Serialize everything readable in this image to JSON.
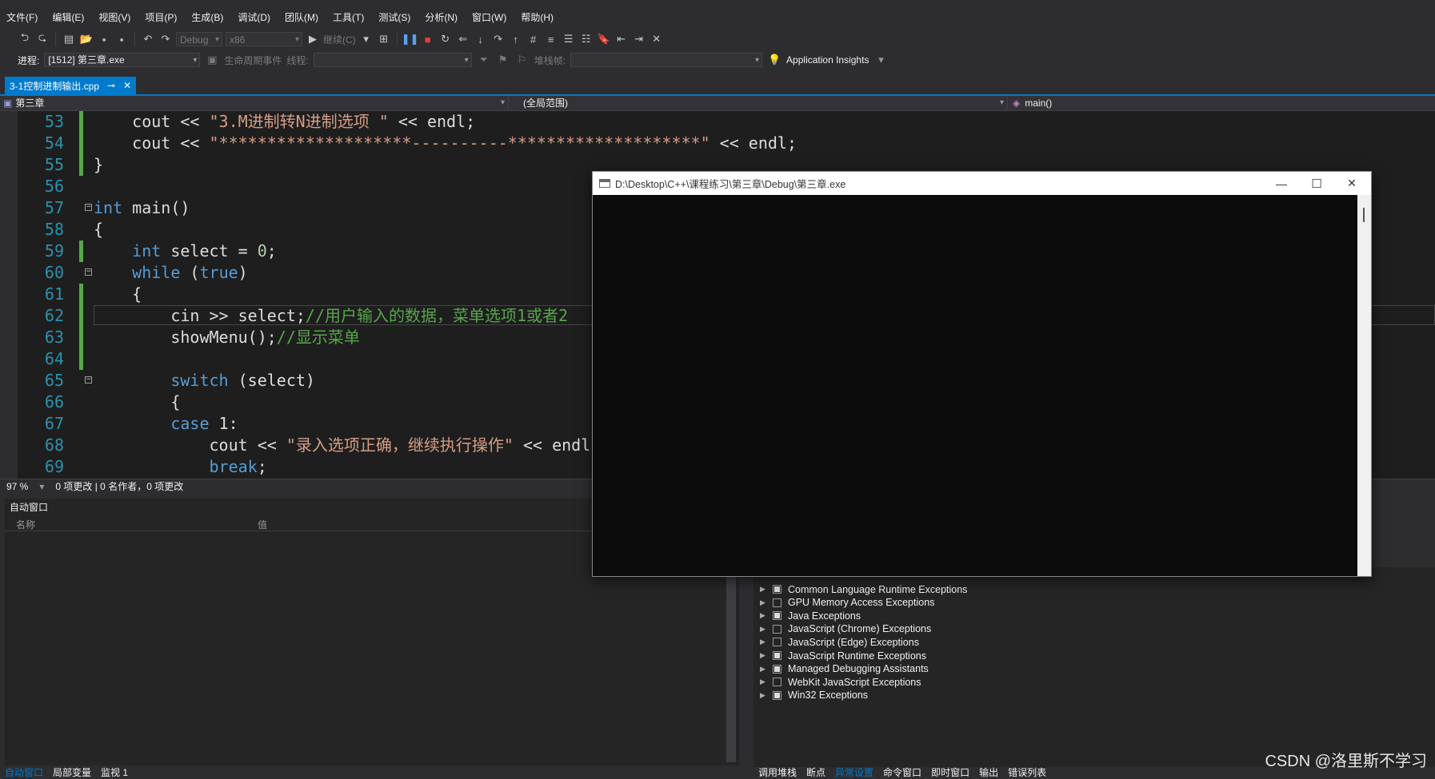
{
  "menu": [
    "文件(F)",
    "编辑(E)",
    "视图(V)",
    "项目(P)",
    "生成(B)",
    "调试(D)",
    "团队(M)",
    "工具(T)",
    "测试(S)",
    "分析(N)",
    "窗口(W)",
    "帮助(H)"
  ],
  "toolbar": {
    "config": "Debug",
    "platform": "x86",
    "continue_label": "继续(C)"
  },
  "process_bar": {
    "process_label": "进程:",
    "process_value": "[1512] 第三章.exe",
    "lifecycle_label": "生命周期事件",
    "thread_label": "线程:",
    "stack_label": "堆栈帧:",
    "insights_label": "Application Insights"
  },
  "editor_tab": {
    "title": "3-1控制进制输出.cpp",
    "pin": "⊸",
    "close": "✕"
  },
  "navbar": {
    "project": "第三章",
    "scope": "(全局范围)",
    "member": "main()"
  },
  "code_lines": [
    {
      "num": "53",
      "parts": [
        [
          "",
          "    cout << "
        ],
        [
          "str",
          "\"3.M进制转N进制选项 \""
        ],
        [
          "",
          " << endl;"
        ]
      ]
    },
    {
      "num": "54",
      "parts": [
        [
          "",
          "    cout << "
        ],
        [
          "str",
          "\"********************----------********************\""
        ],
        [
          "",
          " << endl;"
        ]
      ]
    },
    {
      "num": "55",
      "parts": [
        [
          "",
          "}"
        ]
      ]
    },
    {
      "num": "56",
      "parts": []
    },
    {
      "num": "57",
      "parts": [
        [
          "kw",
          "int"
        ],
        [
          "",
          " main()"
        ]
      ]
    },
    {
      "num": "58",
      "parts": [
        [
          "",
          "{"
        ]
      ]
    },
    {
      "num": "59",
      "parts": [
        [
          "",
          "    "
        ],
        [
          "kw",
          "int"
        ],
        [
          "",
          " select = "
        ],
        [
          "num",
          "0"
        ],
        [
          "",
          ";"
        ]
      ]
    },
    {
      "num": "60",
      "parts": [
        [
          "",
          "    "
        ],
        [
          "kw",
          "while"
        ],
        [
          "",
          " ("
        ],
        [
          "kw",
          "true"
        ],
        [
          "",
          ")"
        ]
      ]
    },
    {
      "num": "61",
      "parts": [
        [
          "",
          "    {"
        ]
      ]
    },
    {
      "num": "62",
      "parts": [
        [
          "",
          "        cin >> select;"
        ],
        [
          "cm",
          "//用户输入的数据，菜单选项1或者2"
        ]
      ]
    },
    {
      "num": "63",
      "parts": [
        [
          "",
          "        showMenu();"
        ],
        [
          "cm",
          "//显示菜单"
        ]
      ]
    },
    {
      "num": "64",
      "parts": []
    },
    {
      "num": "65",
      "parts": [
        [
          "",
          "        "
        ],
        [
          "kw",
          "switch"
        ],
        [
          "",
          " (select)"
        ]
      ]
    },
    {
      "num": "66",
      "parts": [
        [
          "",
          "        {"
        ]
      ]
    },
    {
      "num": "67",
      "parts": [
        [
          "",
          "        "
        ],
        [
          "kw",
          "case"
        ],
        [
          "",
          " 1:"
        ]
      ]
    },
    {
      "num": "68",
      "parts": [
        [
          "",
          "            cout << "
        ],
        [
          "str",
          "\"录入选项正确，继续执行操作\""
        ],
        [
          "",
          " << endl;"
        ]
      ]
    },
    {
      "num": "69",
      "parts": [
        [
          "",
          "            "
        ],
        [
          "kw",
          "break"
        ],
        [
          "",
          ";"
        ]
      ]
    }
  ],
  "editor_status": {
    "zoom": "97 %",
    "changes": "0 项更改 | 0 名作者，0 项更改"
  },
  "auto_window": {
    "title": "自动窗口",
    "col_name": "名称",
    "col_value": "值"
  },
  "exceptions": [
    {
      "label": "Common Language Runtime Exceptions",
      "checked": true
    },
    {
      "label": "GPU Memory Access Exceptions",
      "checked": false
    },
    {
      "label": "Java Exceptions",
      "checked": true
    },
    {
      "label": "JavaScript (Chrome) Exceptions",
      "checked": false
    },
    {
      "label": "JavaScript (Edge) Exceptions",
      "checked": false
    },
    {
      "label": "JavaScript Runtime Exceptions",
      "checked": true
    },
    {
      "label": "Managed Debugging Assistants",
      "checked": true
    },
    {
      "label": "WebKit JavaScript Exceptions",
      "checked": false
    },
    {
      "label": "Win32 Exceptions",
      "checked": true
    }
  ],
  "bottom_tabs_left": [
    {
      "label": "自动窗口",
      "active": true
    },
    {
      "label": "局部变量",
      "active": false
    },
    {
      "label": "监视 1",
      "active": false
    }
  ],
  "bottom_tabs_right": [
    {
      "label": "调用堆栈",
      "active": false
    },
    {
      "label": "断点",
      "active": false
    },
    {
      "label": "异常设置",
      "active": true
    },
    {
      "label": "命令窗口",
      "active": false
    },
    {
      "label": "即时窗口",
      "active": false
    },
    {
      "label": "输出",
      "active": false
    },
    {
      "label": "错误列表",
      "active": false
    }
  ],
  "console": {
    "title": "D:\\Desktop\\C++\\课程练习\\第三章\\Debug\\第三章.exe",
    "minimize": "—",
    "maximize": "☐",
    "close": "✕"
  },
  "watermark": "CSDN @洛里斯不学习",
  "colors": {
    "accent": "#007acc",
    "keyword": "#569cd6",
    "string": "#d69d85",
    "comment": "#57a64a"
  }
}
